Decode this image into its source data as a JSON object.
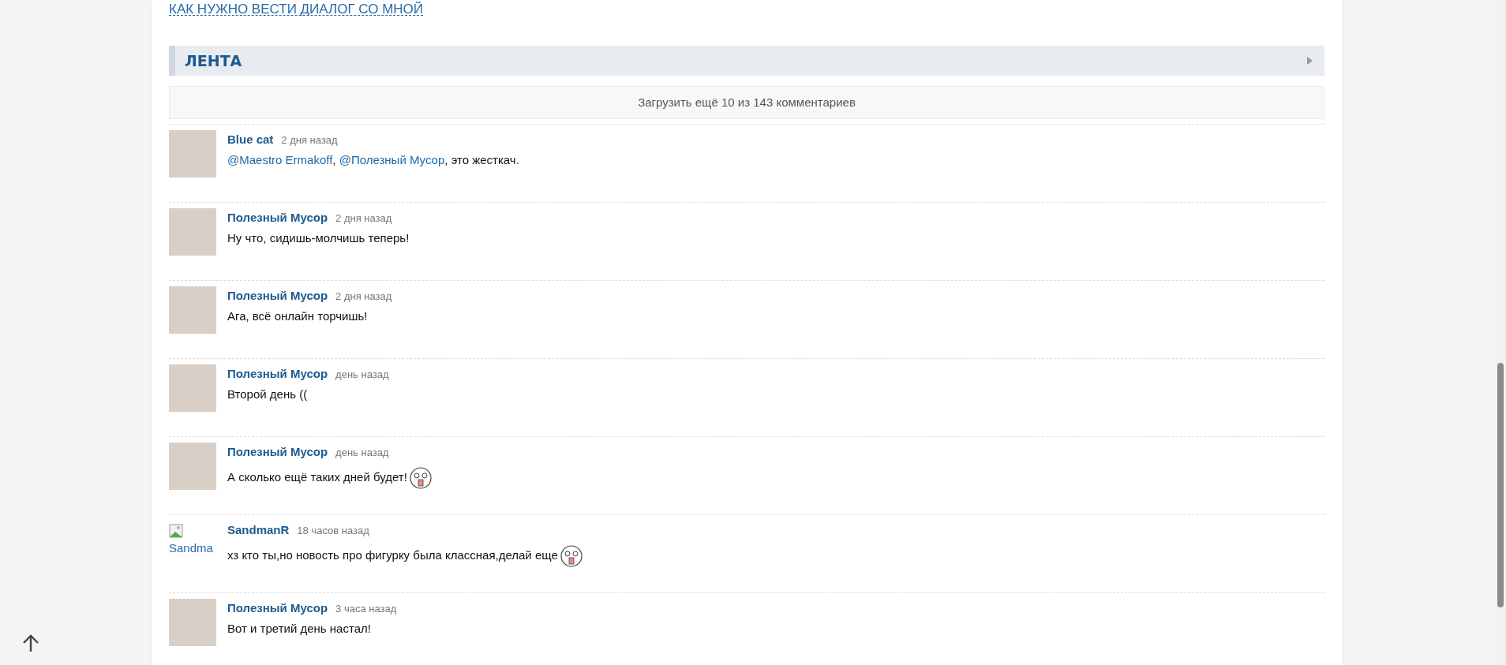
{
  "top_link": "КАК НУЖНО ВЕСТИ ДИАЛОГ СО МНОЙ",
  "section": {
    "title": "ЛЕНТА",
    "expanded": false
  },
  "load_more": "Загрузить ещё 10 из 143 комментариев",
  "comments": [
    {
      "author": "Blue cat",
      "time": "2 дня назад",
      "avatar": {
        "kind": "photo"
      },
      "body": [
        {
          "kind": "mention",
          "text": "@Maestro Ermakoff"
        },
        {
          "kind": "text",
          "text": ", "
        },
        {
          "kind": "mention",
          "text": "@Полезный Мусор"
        },
        {
          "kind": "text",
          "text": ", это жесткач."
        }
      ]
    },
    {
      "author": "Полезный Мусор",
      "time": "2 дня назад",
      "avatar": {
        "kind": "photo"
      },
      "body": [
        {
          "kind": "text",
          "text": "Ну что, сидишь-молчишь теперь!"
        }
      ]
    },
    {
      "author": "Полезный Мусор",
      "time": "2 дня назад",
      "avatar": {
        "kind": "photo"
      },
      "body": [
        {
          "kind": "text",
          "text": "Ага, всё онлайн торчишь!"
        }
      ]
    },
    {
      "author": "Полезный Мусор",
      "time": "день назад",
      "avatar": {
        "kind": "photo"
      },
      "body": [
        {
          "kind": "text",
          "text": "Второй день (("
        }
      ]
    },
    {
      "author": "Полезный Мусор",
      "time": "день назад",
      "avatar": {
        "kind": "photo"
      },
      "body": [
        {
          "kind": "text",
          "text": "А сколько ещё таких дней будет!"
        },
        {
          "kind": "sticker"
        }
      ]
    },
    {
      "author": "SandmanR",
      "time": "18 часов назад",
      "avatar": {
        "kind": "broken",
        "alt": "Sandma"
      },
      "body": [
        {
          "kind": "text",
          "text": "хз кто ты,но новость про фигурку была классная,делай еще"
        },
        {
          "kind": "sticker"
        }
      ]
    },
    {
      "author": "Полезный Мусор",
      "time": "3 часа назад",
      "avatar": {
        "kind": "photo"
      },
      "body": [
        {
          "kind": "text",
          "text": "Вот и третий день настал!"
        }
      ]
    }
  ]
}
